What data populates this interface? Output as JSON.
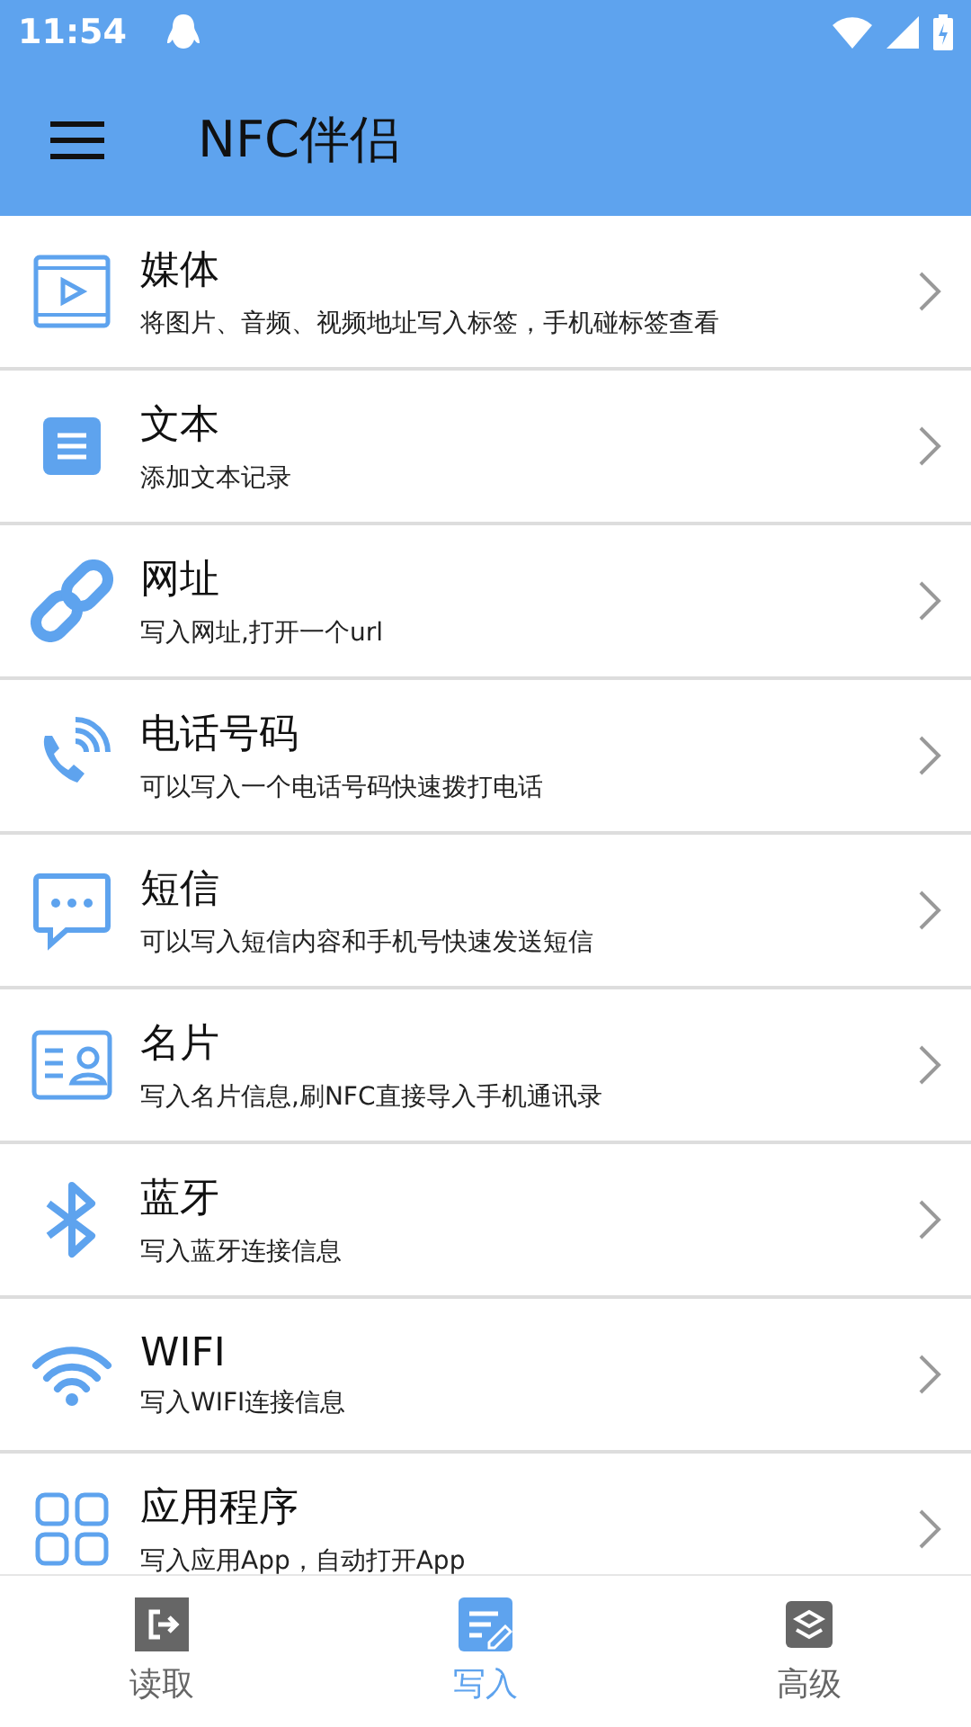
{
  "status_bar": {
    "time": "11:54"
  },
  "app_bar": {
    "title": "NFC伴侣"
  },
  "items": [
    {
      "kind": "media",
      "title": "媒体",
      "subtitle": "将图片、音频、视频地址写入标签，手机碰标签查看"
    },
    {
      "kind": "text",
      "title": "文本",
      "subtitle": "添加文本记录"
    },
    {
      "kind": "link",
      "title": "网址",
      "subtitle": "写入网址,打开一个url"
    },
    {
      "kind": "phone",
      "title": "电话号码",
      "subtitle": "可以写入一个电话号码快速拨打电话"
    },
    {
      "kind": "sms",
      "title": "短信",
      "subtitle": "可以写入短信内容和手机号快速发送短信"
    },
    {
      "kind": "card",
      "title": "名片",
      "subtitle": "写入名片信息,刷NFC直接导入手机通讯录"
    },
    {
      "kind": "bluetooth",
      "title": "蓝牙",
      "subtitle": "写入蓝牙连接信息"
    },
    {
      "kind": "wifi",
      "title": "WIFI",
      "subtitle": "写入WIFI连接信息"
    },
    {
      "kind": "apps",
      "title": "应用程序",
      "subtitle": "写入应用App，自动打开App"
    }
  ],
  "tabs": [
    {
      "kind": "read",
      "label": "读取",
      "selected": false
    },
    {
      "kind": "write",
      "label": "写入",
      "selected": true
    },
    {
      "kind": "advanced",
      "label": "高级",
      "selected": false
    }
  ]
}
